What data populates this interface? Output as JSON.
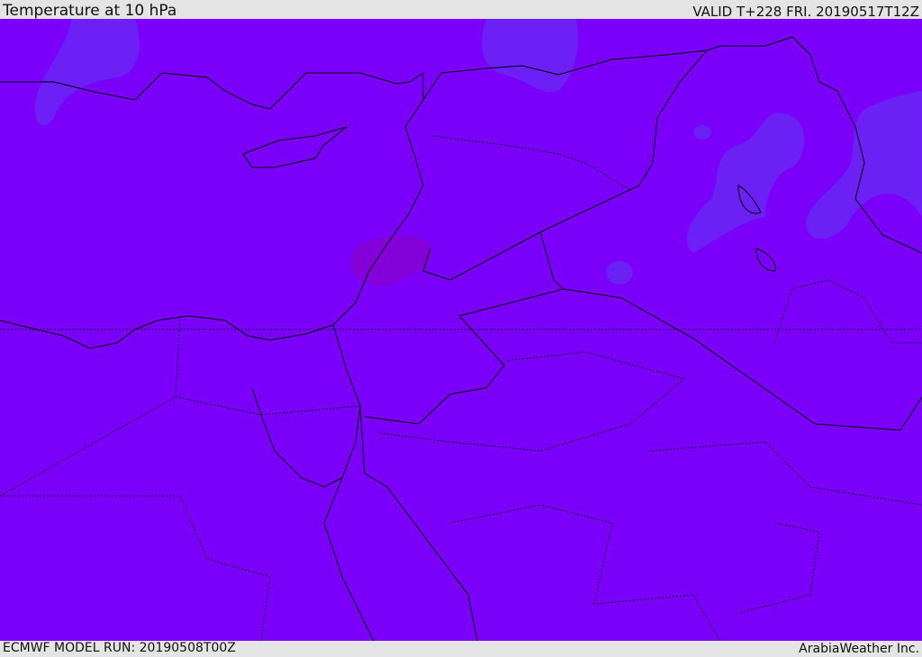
{
  "header": {
    "title": "Temperature at 10 hPa",
    "valid": "VALID T+228 FRI. 20190517T12Z"
  },
  "footer": {
    "model_run": "ECMWF MODEL RUN: 20190508T00Z",
    "credit": "ArabiaWeather Inc."
  },
  "map": {
    "region": "Eastern Mediterranean / Middle East",
    "colors": {
      "background": "#7a00fa",
      "cooler_patch": "#6a24f4",
      "warmer_patch": "#8300d8",
      "coastline": "#000000"
    }
  }
}
